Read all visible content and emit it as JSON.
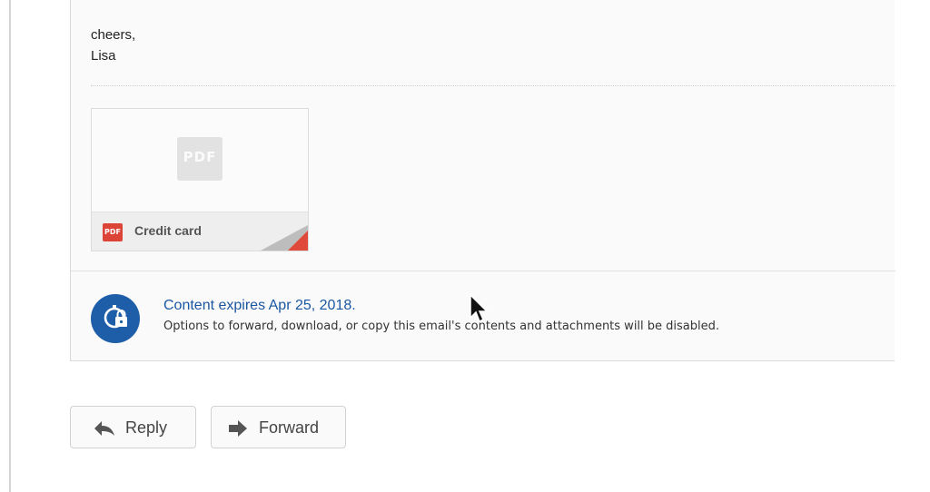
{
  "message": {
    "signoff": [
      "cheers,",
      "Lisa"
    ]
  },
  "attachment": {
    "thumbnail_label": "PDF",
    "type_badge": "PDF",
    "name": "Credit card"
  },
  "expiration": {
    "title": "Content expires Apr 25, 2018.",
    "description": "Options to forward, download, or copy this email's contents and attachments will be disabled."
  },
  "actions": {
    "reply_label": "Reply",
    "forward_label": "Forward"
  },
  "colors": {
    "link_blue": "#1a57a2",
    "icon_circle": "#1e5ea8",
    "pdf_red": "#db4437"
  },
  "icons": {
    "expiry": "clock-lock-icon",
    "reply": "reply-arrow-icon",
    "forward": "forward-arrow-icon",
    "pointer": "mouse-pointer-icon"
  }
}
